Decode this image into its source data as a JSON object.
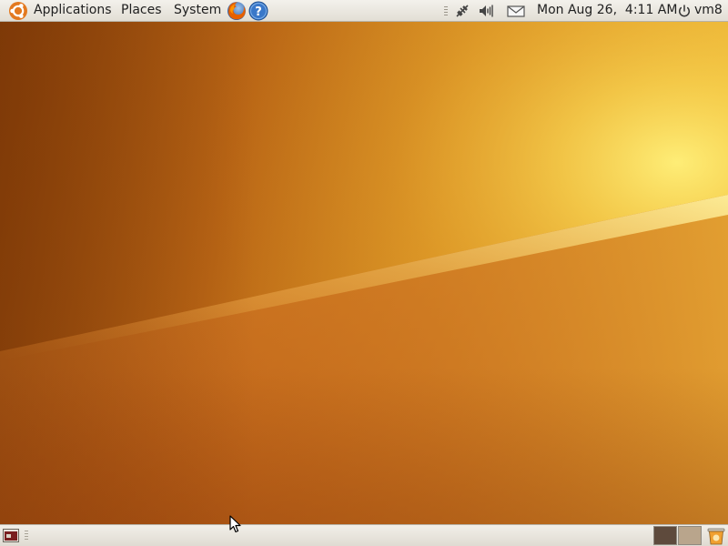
{
  "top_panel": {
    "menus": {
      "applications": "Applications",
      "places": "Places",
      "system": "System"
    },
    "launchers": [
      "firefox-browser",
      "help-center"
    ],
    "indicators": [
      "network-disconnected",
      "volume",
      "mail"
    ],
    "clock": "Mon Aug 26,  4:11 AM",
    "user": "vm8"
  },
  "bottom_panel": {
    "workspaces": [
      {
        "name": "workspace-1",
        "active": true,
        "color": "#5e4a3c"
      },
      {
        "name": "workspace-2",
        "active": false,
        "color": "#b9a58c"
      }
    ]
  },
  "colors": {
    "panel": "#e9e6df",
    "wallpaper_dark": "#8a3e06",
    "wallpaper_mid": "#d3871f",
    "wallpaper_light": "#f6d24e"
  }
}
